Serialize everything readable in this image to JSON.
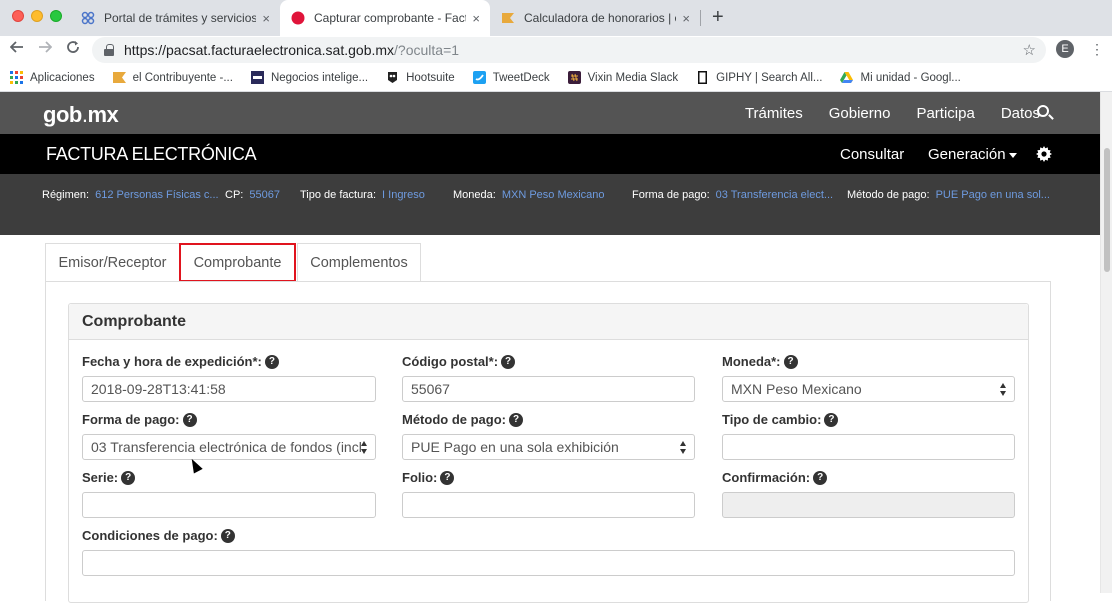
{
  "browser": {
    "tabs": [
      {
        "title": "Portal de trámites y servicios -",
        "close": "×"
      },
      {
        "title": "Capturar comprobante - Factur",
        "close": "×"
      },
      {
        "title": "Calculadora de honorarios | el",
        "close": "×"
      }
    ],
    "new_tab": "+",
    "url_host": "https://pacsat.facturaelectronica.sat.gob.mx",
    "url_rest": "/?oculta=1",
    "profile_initial": "E",
    "bookmarks": [
      {
        "label": "Aplicaciones",
        "icon": "apps-grid-icon"
      },
      {
        "label": "el Contribuyente -...",
        "icon": "bookmark-flag-icon"
      },
      {
        "label": "Negocios intelige...",
        "icon": "site-logo-icon"
      },
      {
        "label": "Hootsuite",
        "icon": "owl-icon"
      },
      {
        "label": "TweetDeck",
        "icon": "tweetdeck-icon"
      },
      {
        "label": "Vixin Media Slack",
        "icon": "slack-icon"
      },
      {
        "label": "GIPHY | Search All...",
        "icon": "giphy-icon"
      },
      {
        "label": "Mi unidad - Googl...",
        "icon": "drive-icon"
      }
    ],
    "colors": {
      "tab_red_favicon": "#e0143a"
    }
  },
  "gob": {
    "logo_left": "gob",
    "logo_dot": ".",
    "logo_right": "mx",
    "nav": [
      "Trámites",
      "Gobierno",
      "Participa",
      "Datos"
    ]
  },
  "factura": {
    "title": "FACTURA ELECTRÓNICA",
    "consultar": "Consultar",
    "generacion": "Generación"
  },
  "info": {
    "regimen_k": "Régimen:",
    "regimen_v": "612 Personas Físicas c...",
    "cp_k": "CP:",
    "cp_v": "55067",
    "tipo_k": "Tipo de factura:",
    "tipo_v": "I Ingreso",
    "moneda_k": "Moneda:",
    "moneda_v": "MXN Peso Mexicano",
    "forma_k": "Forma de pago:",
    "forma_v": "03 Transferencia elect...",
    "metodo_k": "Método de pago:",
    "metodo_v": "PUE Pago en una sol..."
  },
  "tabs": {
    "emisor": "Emisor/Receptor",
    "comprobante": "Comprobante",
    "complementos": "Complementos"
  },
  "section": {
    "title": "Comprobante",
    "help_glyph": "?",
    "fecha_label": "Fecha y hora de expedición*:",
    "fecha_value": "2018-09-28T13:41:58",
    "cp_label": "Código postal*:",
    "cp_value": "55067",
    "moneda_label": "Moneda*:",
    "moneda_value": "MXN Peso Mexicano",
    "forma_label": "Forma de pago:",
    "forma_value": "03 Transferencia electrónica de fondos (incl",
    "metodo_label": "Método de pago:",
    "metodo_value": "PUE Pago en una sola exhibición",
    "tipo_cambio_label": "Tipo de cambio:",
    "tipo_cambio_value": "",
    "serie_label": "Serie:",
    "serie_value": "",
    "folio_label": "Folio:",
    "folio_value": "",
    "confirmacion_label": "Confirmación:",
    "confirmacion_value": "",
    "condiciones_label": "Condiciones de pago:",
    "condiciones_value": ""
  }
}
